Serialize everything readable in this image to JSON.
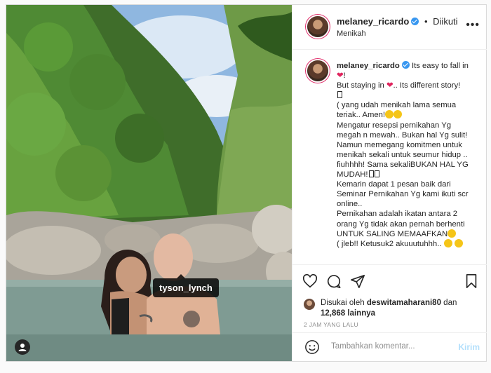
{
  "header": {
    "username": "melaney_ricardo",
    "separator": "•",
    "follow_status": "Diikuti",
    "subtitle": "Menikah",
    "more_icon": "more-icon"
  },
  "caption": {
    "username": "melaney_ricardo",
    "lines": [
      "Its easy to fall in",
      "!",
      "But staying in",
      ".. Its different story!",
      "( yang udah menikah lama semua teriak.. Amen!",
      "Mengatur resepsi pernikahan Yg megah n mewah.. Bukan hal Yg sulit! Namun memegang komitmen untuk menikah sekali untuk seumur hidup .. fiuhhhh! Sama sekaliBUKAN HAL YG MUDAH!",
      "Kemarin dapat 1 pesan baik dari Seminar Pernikahan Yg kami ikuti scr online..",
      "Pernikahan adalah ikatan antara 2 orang Yg tidak akan pernah berhenti UNTUK SALING MEMAAFKAN",
      "( jleb!! Ketusuk2 akuuutuhhh.."
    ]
  },
  "photo": {
    "tag": "tyson_lynch"
  },
  "likes": {
    "prefix": "Disukai oleh",
    "liker": "deswitamaharani80",
    "connector": "dan",
    "count": "12,868",
    "suffix": "lainnya"
  },
  "time_ago": "2 JAM YANG LALU",
  "comment": {
    "placeholder": "Tambahkan komentar...",
    "post_label": "Kirim"
  },
  "colors": {
    "verified": "#3897f0",
    "heart": "#e0245e",
    "post_button_disabled": "#b2dffc"
  }
}
